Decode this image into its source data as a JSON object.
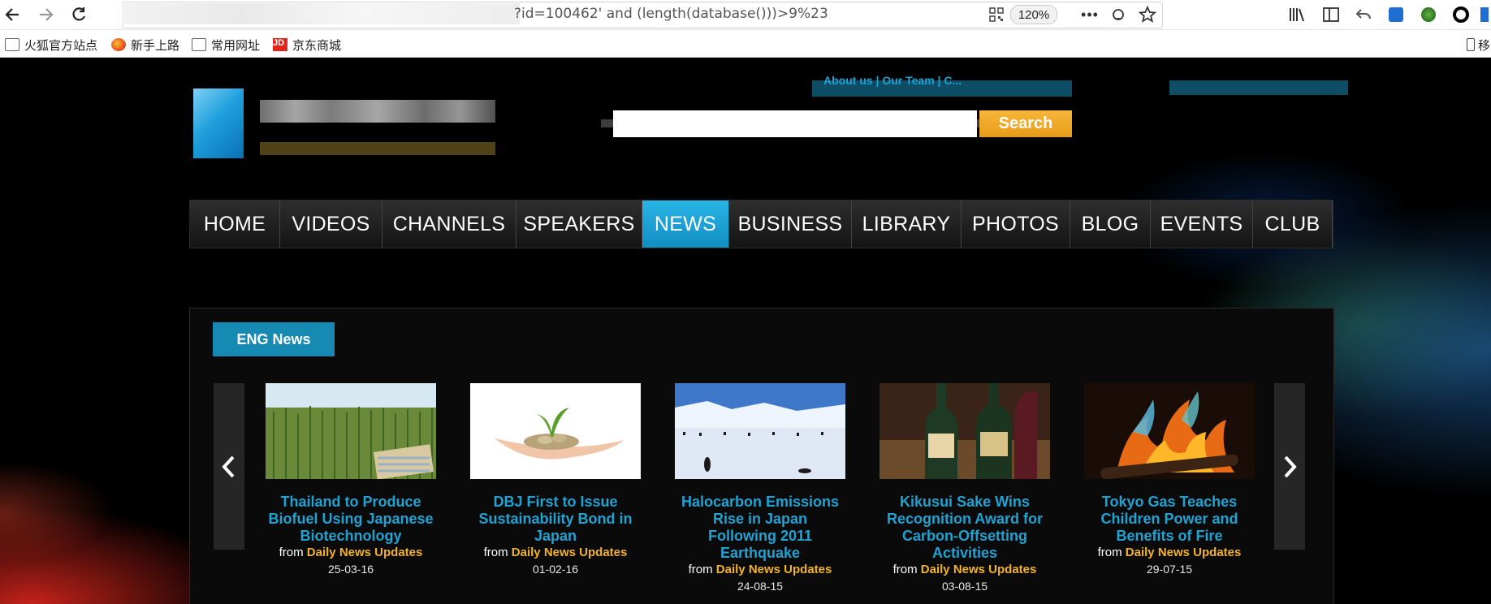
{
  "browser": {
    "url_text": "?id=100462' and (length(database()))>9%23",
    "zoom": "120%",
    "bookmarks": [
      {
        "label": "火狐官方站点",
        "icon": "folder-icon"
      },
      {
        "label": "新手上路",
        "icon": "firefox-icon"
      },
      {
        "label": "常用网址",
        "icon": "folder-icon"
      },
      {
        "label": "京东商城",
        "icon": "jd-icon"
      }
    ],
    "mobile_label": "移"
  },
  "header": {
    "top_link": "About us | Our Team | C...",
    "search_button": "Search",
    "search_placeholder": ""
  },
  "nav": {
    "items": [
      "HOME",
      "VIDEOS",
      "CHANNELS",
      "SPEAKERS",
      "NEWS",
      "BUSINESS",
      "LIBRARY",
      "PHOTOS",
      "BLOG",
      "EVENTS",
      "CLUB"
    ],
    "active": "NEWS"
  },
  "news": {
    "tab_label": "ENG News",
    "from_label": "from",
    "items": [
      {
        "headline": "Thailand to Produce Biofuel Using Japanese Biotechnology",
        "source": "Daily News Updates",
        "date": "25-03-16",
        "image": "sugarcane-field-image"
      },
      {
        "headline": "DBJ First to Issue Sustainability Bond in Japan",
        "source": "Daily News Updates",
        "date": "01-02-16",
        "image": "coins-hands-plant-image"
      },
      {
        "headline": "Halocarbon Emissions Rise in Japan Following 2011 Earthquake",
        "source": "Daily News Updates",
        "date": "24-08-15",
        "image": "penguins-ice-image"
      },
      {
        "headline": "Kikusui Sake Wins Recognition Award for Carbon-Offsetting Activities",
        "source": "Daily News Updates",
        "date": "03-08-15",
        "image": "sake-bottles-image"
      },
      {
        "headline": "Tokyo Gas Teaches Children Power and Benefits of Fire",
        "source": "Daily News Updates",
        "date": "29-07-15",
        "image": "fire-image"
      }
    ]
  }
}
